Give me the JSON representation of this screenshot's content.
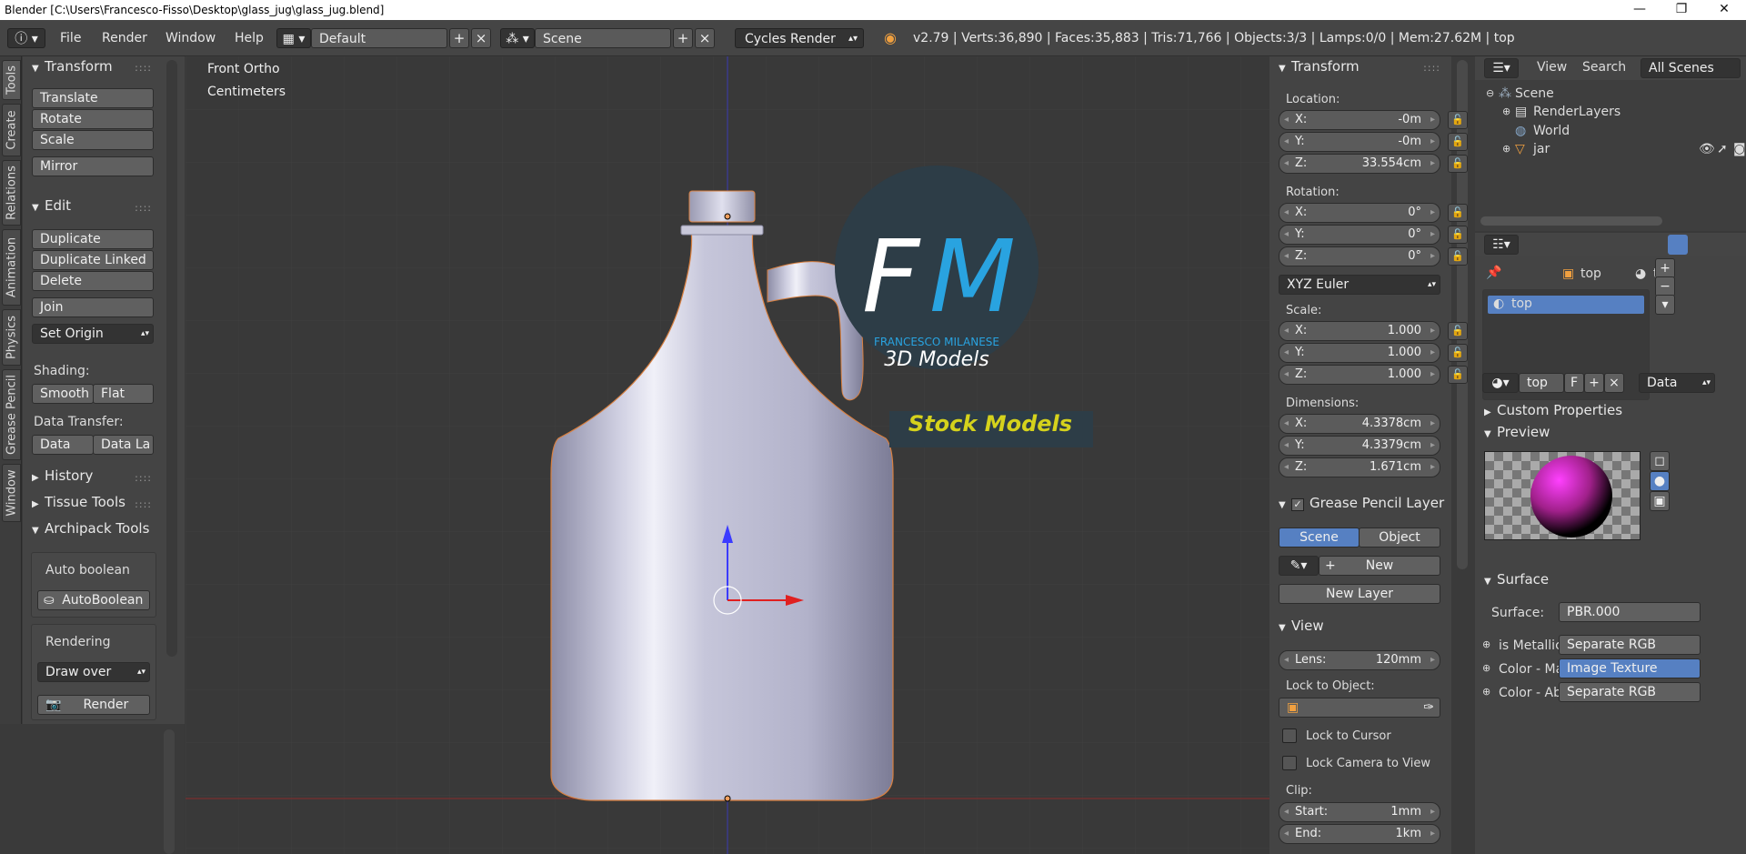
{
  "titlebar": {
    "title": "Blender [C:\\Users\\Francesco-Fisso\\Desktop\\glass_jug\\glass_jug.blend]",
    "min": "—",
    "max": "❐",
    "close": "✕"
  },
  "topbar": {
    "menus": [
      "File",
      "Render",
      "Window",
      "Help"
    ],
    "screen_layout": "Default",
    "scene": "Scene",
    "engine": "Cycles Render",
    "stats": "v2.79 | Verts:36,890 | Faces:35,883 | Tris:71,766 | Objects:3/3 | Lamps:0/0 | Mem:27.62M | top"
  },
  "vtabs": [
    "Tools",
    "Create",
    "Relations",
    "Animation",
    "Physics",
    "Grease Pencil",
    "Window"
  ],
  "toolshelf": {
    "transform": {
      "title": "Transform",
      "buttons": [
        "Translate",
        "Rotate",
        "Scale",
        "Mirror"
      ]
    },
    "edit": {
      "title": "Edit",
      "buttons": [
        "Duplicate",
        "Duplicate Linked",
        "Delete",
        "Join"
      ],
      "set_origin": "Set Origin",
      "shading_label": "Shading:",
      "smooth": "Smooth",
      "flat": "Flat",
      "data_transfer_label": "Data Transfer:",
      "data": "Data",
      "data_la": "Data La"
    },
    "history": "History",
    "tissue": "Tissue Tools",
    "archipack": "Archipack Tools",
    "auto_boolean_label": "Auto boolean",
    "auto_boolean_btn": "AutoBoolean",
    "rendering_label": "Rendering",
    "draw_over": "Draw over",
    "render_btn": "Render"
  },
  "viewport": {
    "view_name": "Front Ortho",
    "units": "Centimeters",
    "logo": {
      "letters_f": "F",
      "letters_m": "M",
      "brand": "FRANCESCO MILANESE",
      "sub": "3D Models",
      "stock": "Stock Models"
    }
  },
  "npanel": {
    "transform_title": "Transform",
    "location_label": "Location:",
    "loc": [
      {
        "k": "X:",
        "v": "-0m"
      },
      {
        "k": "Y:",
        "v": "-0m"
      },
      {
        "k": "Z:",
        "v": "33.554cm"
      }
    ],
    "rotation_label": "Rotation:",
    "rot": [
      {
        "k": "X:",
        "v": "0°"
      },
      {
        "k": "Y:",
        "v": "0°"
      },
      {
        "k": "Z:",
        "v": "0°"
      }
    ],
    "euler": "XYZ Euler",
    "scale_label": "Scale:",
    "scale": [
      {
        "k": "X:",
        "v": "1.000"
      },
      {
        "k": "Y:",
        "v": "1.000"
      },
      {
        "k": "Z:",
        "v": "1.000"
      }
    ],
    "dimensions_label": "Dimensions:",
    "dim": [
      {
        "k": "X:",
        "v": "4.3378cm"
      },
      {
        "k": "Y:",
        "v": "4.3379cm"
      },
      {
        "k": "Z:",
        "v": "1.671cm"
      }
    ],
    "gp_title": "Grease Pencil Layer",
    "gp_scene": "Scene",
    "gp_object": "Object",
    "gp_new": "New",
    "gp_new_layer": "New Layer",
    "view_title": "View",
    "lens_k": "Lens:",
    "lens_v": "120mm",
    "lock_obj": "Lock to Object:",
    "lock_cursor": "Lock to Cursor",
    "lock_cam": "Lock Camera to View",
    "clip": "Clip:",
    "start_k": "Start:",
    "start_v": "1mm",
    "end_k": "End:",
    "end_v": "1km"
  },
  "outliner": {
    "view": "View",
    "search": "Search",
    "all_scenes": "All Scenes",
    "items": [
      "Scene",
      "RenderLayers",
      "World",
      "jar"
    ]
  },
  "props": {
    "crumb1": "top",
    "crumb2": "top",
    "slot": "top",
    "mat_name": "top",
    "mat_f": "F",
    "data_sel": "Data",
    "custom_props": "Custom Properties",
    "preview": "Preview",
    "surface": "Surface",
    "surface_label": "Surface:",
    "surface_val": "PBR.000",
    "rows": [
      {
        "k": "is Metallic",
        "v": "Separate RGB"
      },
      {
        "k": "Color - Ma",
        "v": "Image Texture"
      },
      {
        "k": "Color - Ab",
        "v": "Separate RGB"
      }
    ]
  },
  "colors": {
    "accent": "#5680c2",
    "logo_blue": "#29a3e0",
    "stock_yellow": "#d5d21c"
  }
}
